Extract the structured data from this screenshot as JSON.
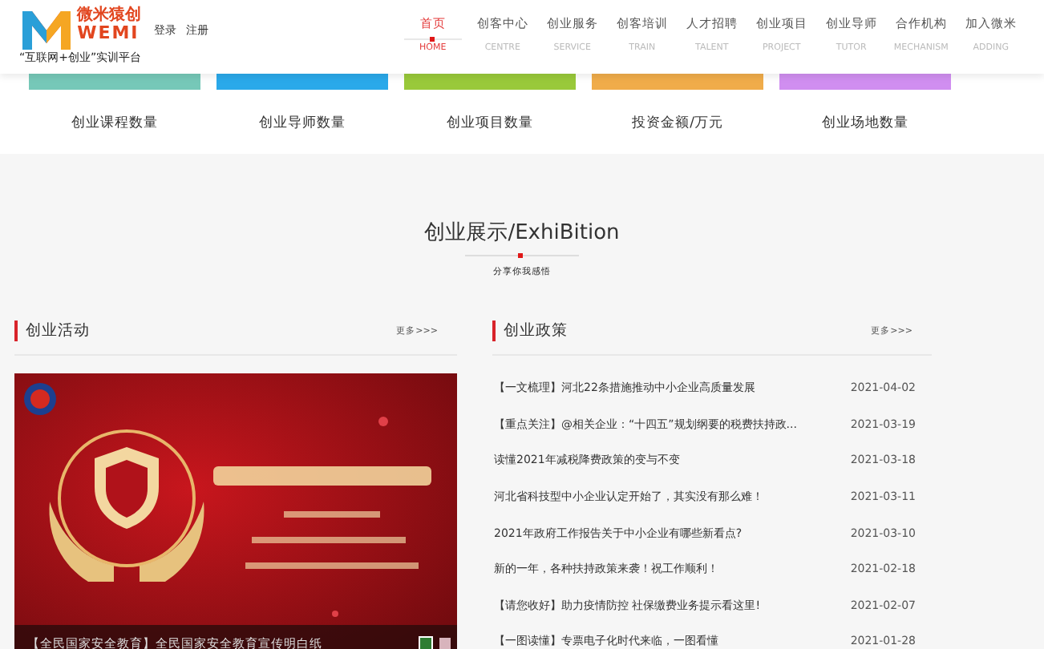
{
  "header": {
    "logo": {
      "name": "微米猿创",
      "brand": "WEMI",
      "slogan": "“互联网+创业”实训平台"
    },
    "auth_links": [
      "登录",
      "注册"
    ],
    "nav": [
      {
        "label": "首页",
        "sublabel": "HOME",
        "selected": true
      },
      {
        "label": "创客中心",
        "sublabel": "CENTRE",
        "selected": false
      },
      {
        "label": "创业服务",
        "sublabel": "SERVICE",
        "selected": false
      },
      {
        "label": "创客培训",
        "sublabel": "TRAIN",
        "selected": false
      },
      {
        "label": "人才招聘",
        "sublabel": "TALENT",
        "selected": false
      },
      {
        "label": "创业项目",
        "sublabel": "PROJECT",
        "selected": false
      },
      {
        "label": "创业导师",
        "sublabel": "TUTOR",
        "selected": false
      },
      {
        "label": "合作机构",
        "sublabel": "MECHANISM",
        "selected": false
      },
      {
        "label": "加入微米",
        "sublabel": "ADDING",
        "selected": false
      }
    ]
  },
  "stats": [
    {
      "label": "创业课程数量",
      "color": "#76c8b8"
    },
    {
      "label": "创业导师数量",
      "color": "#2aa9ea"
    },
    {
      "label": "创业项目数量",
      "color": "#99c93a"
    },
    {
      "label": "投资金额/万元",
      "color": "#f0ac4a"
    },
    {
      "label": "创业场地数量",
      "color": "#d08ef0"
    }
  ],
  "section": {
    "title": "创业展示/ExhiBition",
    "subtitle": "分享你我感悟"
  },
  "activities": {
    "title": "创业活动",
    "more": "更多>>>",
    "caption": "【全民国家安全教育】全民国家安全教育宣传明白纸",
    "dots": [
      {
        "color": "#2e7d32",
        "selected": true
      },
      {
        "color": "#d8b4bc",
        "selected": false
      }
    ]
  },
  "policies": {
    "title": "创业政策",
    "more": "更多>>>",
    "items": [
      {
        "title": "【一文梳理】河北22条措施推动中小企业高质量发展",
        "date": "2021-04-02"
      },
      {
        "title": "【重点关注】@相关企业：“十四五”规划纲要的税费扶持政...",
        "date": "2021-03-19"
      },
      {
        "title": "读懂2021年减税降费政策的变与不变",
        "date": "2021-03-18"
      },
      {
        "title": "河北省科技型中小企业认定开始了，其实没有那么难！",
        "date": "2021-03-11"
      },
      {
        "title": "2021年政府工作报告关于中小企业有哪些新看点?",
        "date": "2021-03-10"
      },
      {
        "title": "新的一年，各种扶持政策来袭！祝工作顺利！",
        "date": "2021-02-18"
      },
      {
        "title": "【请您收好】助力疫情防控 社保缴费业务提示看这里!",
        "date": "2021-02-07"
      },
      {
        "title": "【一图读懂】专票电子化时代来临，一图看懂",
        "date": "2021-01-28"
      }
    ]
  }
}
